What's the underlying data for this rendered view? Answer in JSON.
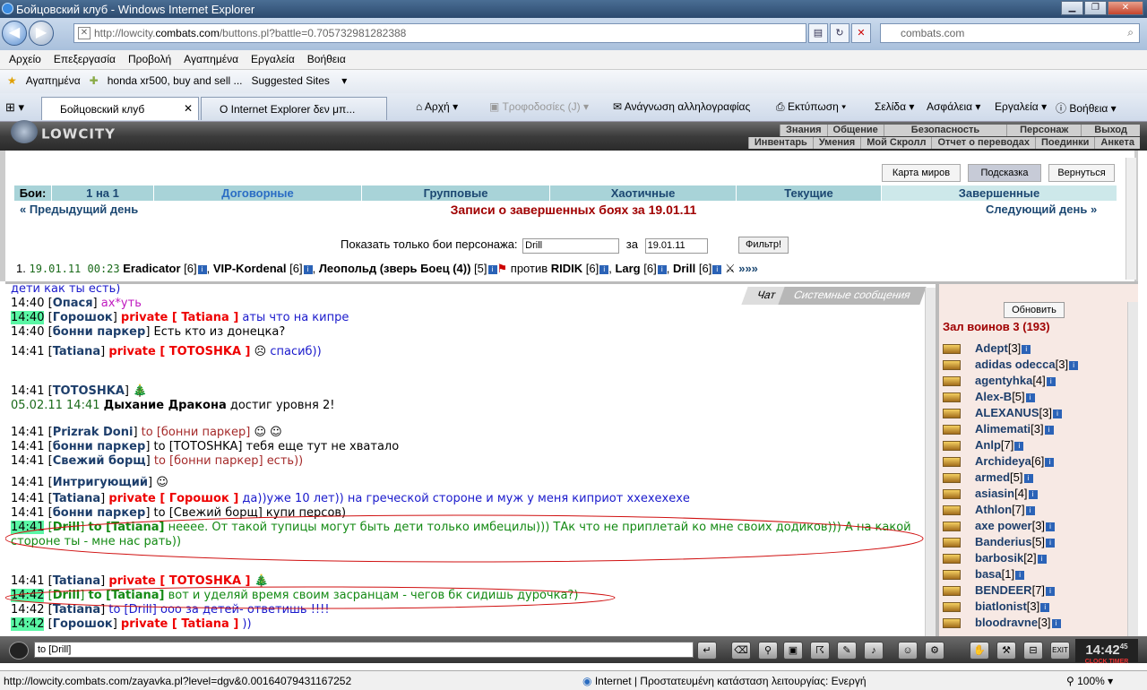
{
  "window": {
    "title": "Бойцовский клуб - Windows Internet Explorer"
  },
  "address": {
    "url_prefix": "http://lowcity.",
    "url_domain": "combats.com",
    "url_suffix": "/buttons.pl?battle=0.705732981282388",
    "search": "combats.com"
  },
  "menu": [
    "Αρχείο",
    "Επεξεργασία",
    "Προβολή",
    "Αγαπημένα",
    "Εργαλεία",
    "Βοήθεια"
  ],
  "favbar": {
    "fav": "Αγαπημένα",
    "ebay": "honda xr500, buy and sell ...",
    "suggested": "Suggested Sites"
  },
  "tabs": [
    {
      "label": "Бойцовский клуб"
    },
    {
      "label": "Ο Internet Explorer δεν μπ..."
    }
  ],
  "toolbar": {
    "home": "Αρχή",
    "feeds": "Τροφοδοσίες (J)",
    "mail": "Ανάγνωση αλληλογραφίας",
    "print": "Εκτύπωση",
    "page": "Σελίδα",
    "safety": "Ασφάλεια",
    "tools": "Εργαλεία",
    "help": "Βοήθεια"
  },
  "game": {
    "logo": "LOWCITY",
    "menu1": [
      "Знания",
      "Общение",
      "Безопасность",
      "Персонаж",
      "Выход"
    ],
    "menu2": [
      "Инвентарь",
      "Умения",
      "Мой Скролл",
      "Отчет о переводах",
      "Поединки",
      "Анкета"
    ]
  },
  "panel": {
    "buttons": [
      "Карта миров",
      "Подсказка",
      "Вернуться"
    ],
    "battles_label": "Бои:",
    "battle_tabs": [
      "1 на 1",
      "Договорные",
      "Групповые",
      "Хаотичные",
      "Текущие",
      "Завершенные"
    ],
    "prev_day": "« Предыдущий день",
    "next_day": "Следующий день »",
    "headline": "Записи о завершенных боях за 19.01.11",
    "filter_label": "Показать только бои персонажа:",
    "filter_name": "Drill",
    "filter_za": "за",
    "filter_date": "19.01.11",
    "filter_btn": "Фильтр!",
    "battle": {
      "idx": "1.",
      "date": "19.01.11 00:23",
      "vs": "против",
      "more": "»»»"
    }
  },
  "chat": {
    "tabs": [
      "Чат",
      "Системные сообщения"
    ],
    "top_cut": "дети как ты есть)"
  },
  "right": {
    "refresh": "Обновить",
    "hall": "Зал воинов 3 (193)",
    "players": [
      [
        "Adept",
        "[3]"
      ],
      [
        "adidas odecca",
        "[3]"
      ],
      [
        "agentyhka",
        "[4]"
      ],
      [
        "Alex-B",
        "[5]"
      ],
      [
        "ALEXANUS",
        "[3]"
      ],
      [
        "Alimemati",
        "[3]"
      ],
      [
        "Anlp",
        "[7]"
      ],
      [
        "Archideya",
        "[6]"
      ],
      [
        "armed",
        "[5]"
      ],
      [
        "asiasin",
        "[4]"
      ],
      [
        "Athlon",
        "[7]"
      ],
      [
        "axe power",
        "[3]"
      ],
      [
        "Banderius",
        "[5]"
      ],
      [
        "barbosik",
        "[2]"
      ],
      [
        "basa",
        "[1]"
      ],
      [
        "BENDEER",
        "[7]"
      ],
      [
        "biatlonist",
        "[3]"
      ],
      [
        "bloodravne",
        "[3]"
      ]
    ]
  },
  "input": {
    "value": "to [Drill]",
    "clock": "14:42",
    "clock_sec": "45",
    "clock_label": "CLOCK TIMER"
  },
  "status": {
    "url": "http://lowcity.combats.com/zayavka.pl?level=dgv&0.00164079431167252",
    "zone": "Internet | Προστατευμένη κατάσταση λειτουργίας: Ενεργή",
    "zoom": "100%"
  }
}
